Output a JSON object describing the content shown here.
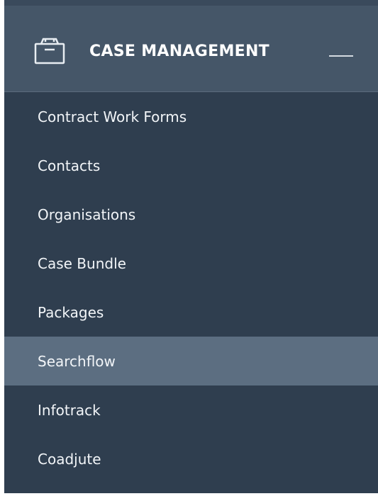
{
  "section": {
    "title": "CASE MANAGEMENT",
    "header_icon": "case-box-icon",
    "collapse_icon": "minus-icon"
  },
  "menu": {
    "items": [
      {
        "label": "Contract Work Forms",
        "active": false
      },
      {
        "label": "Contacts",
        "active": false
      },
      {
        "label": "Organisations",
        "active": false
      },
      {
        "label": "Case Bundle",
        "active": false
      },
      {
        "label": "Packages",
        "active": false
      },
      {
        "label": "Searchflow",
        "active": true
      },
      {
        "label": "Infotrack",
        "active": false
      },
      {
        "label": "Coadjute",
        "active": false
      }
    ]
  },
  "colors": {
    "sidebar_bg": "#2f3e4f",
    "header_bg": "#455668",
    "active_bg": "#5c6e81",
    "text": "#f2f5f8"
  }
}
